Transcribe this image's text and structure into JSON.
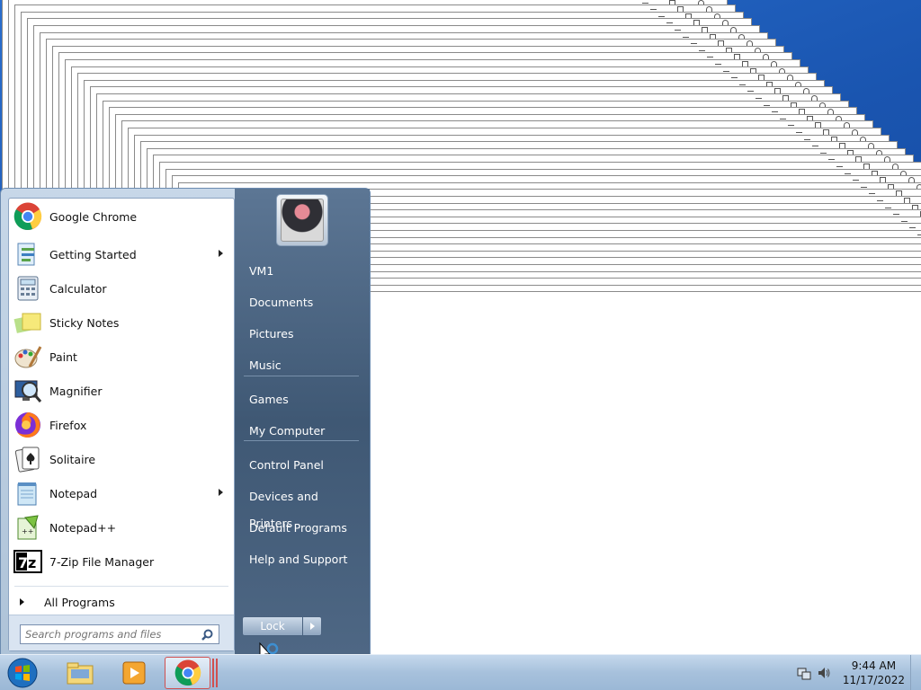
{
  "start_menu": {
    "pinned_programs": [
      {
        "label": "Google Chrome",
        "icon": "chrome-icon",
        "submenu": false
      },
      {
        "label": "Getting Started",
        "icon": "getting-started-icon",
        "submenu": true
      },
      {
        "label": "Calculator",
        "icon": "calculator-icon",
        "submenu": false
      },
      {
        "label": "Sticky Notes",
        "icon": "sticky-notes-icon",
        "submenu": false
      },
      {
        "label": "Paint",
        "icon": "paint-icon",
        "submenu": false
      },
      {
        "label": "Magnifier",
        "icon": "magnifier-icon",
        "submenu": false
      },
      {
        "label": "Firefox",
        "icon": "firefox-icon",
        "submenu": false
      },
      {
        "label": "Solitaire",
        "icon": "solitaire-icon",
        "submenu": false
      },
      {
        "label": "Notepad",
        "icon": "notepad-icon",
        "submenu": true
      },
      {
        "label": "Notepad++",
        "icon": "notepad-plus-plus-icon",
        "submenu": false
      },
      {
        "label": "7-Zip File Manager",
        "icon": "7zip-icon",
        "submenu": false
      }
    ],
    "all_programs_label": "All Programs",
    "search_placeholder": "Search programs and files",
    "right_links": [
      {
        "label": "VM1"
      },
      {
        "label": "Documents"
      },
      {
        "label": "Pictures"
      },
      {
        "label": "Music"
      },
      {
        "label": "Games"
      },
      {
        "label": "My Computer"
      },
      {
        "label": "Control Panel"
      },
      {
        "label": "Devices and Printers"
      },
      {
        "label": "Default Programs"
      },
      {
        "label": "Help and Support"
      }
    ],
    "lock_label": "Lock"
  },
  "taskbar": {
    "items": [
      "start-orb",
      "explorer-icon",
      "media-player-icon",
      "chrome-icon"
    ],
    "clock_time": "9:44 AM",
    "clock_date": "11/17/2022"
  },
  "colors": {
    "desktop": "#1a55b0",
    "menu_right_pane": "#3f5874",
    "taskbar": "#a7c1dc"
  }
}
